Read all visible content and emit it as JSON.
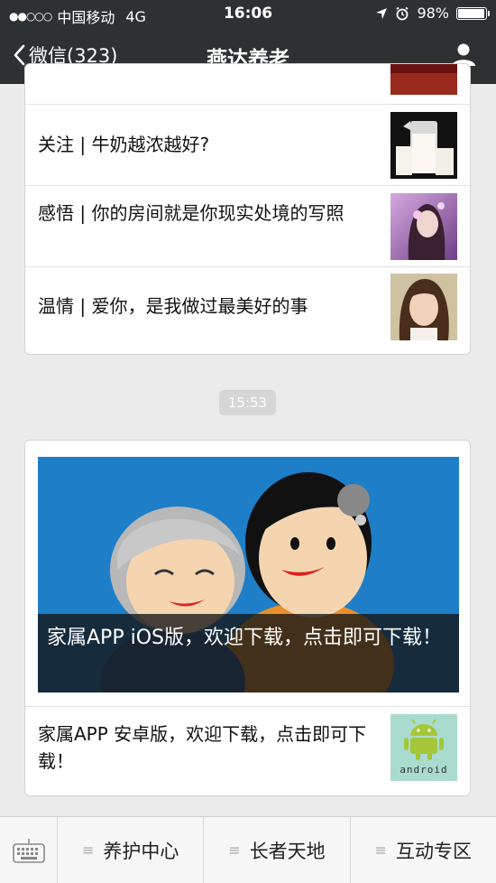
{
  "status_bar": {
    "signal": "●●○○○",
    "carrier": "中国移动",
    "network": "4G",
    "time": "16:06",
    "battery": "98%",
    "battery_level": 0.98
  },
  "nav": {
    "back_label": "微信(323)",
    "title": "燕达养老"
  },
  "articles": [
    {
      "title": "关注 | 牛奶越浓越好?",
      "thumb": "milk-image"
    },
    {
      "title": "感悟 | 你的房间就是你现实处境的写照",
      "thumb": "woman-flowers-image"
    },
    {
      "title": "温情 | 爱你，是我做过最美好的事",
      "thumb": "girl-portrait-image"
    }
  ],
  "timestamp": "15:53",
  "card2": {
    "hero_caption": "家属APP iOS版，欢迎下载，点击即可下载！",
    "item_title": "家属APP 安卓版，欢迎下载，点击即可下载！",
    "item_thumb_text": "android"
  },
  "bottom_menu": {
    "items": [
      "养护中心",
      "长者天地",
      "互动专区"
    ]
  },
  "colors": {
    "topbar": "#2e3132",
    "background": "#ebebeb",
    "hero_blue": "#1e7ec8",
    "android_green": "#a4c639"
  }
}
